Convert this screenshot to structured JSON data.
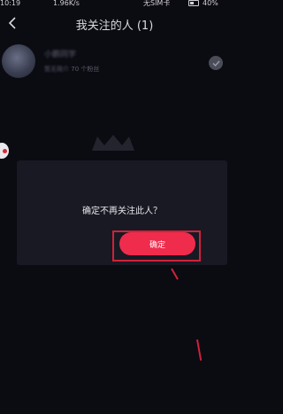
{
  "status_bar": {
    "time": "10:19",
    "speed": "1.96K/s",
    "carrier": "无SIM卡",
    "battery": "40%"
  },
  "header": {
    "title": "我关注的人 (1)",
    "back_icon": "chevron-left-icon"
  },
  "follow_list": [
    {
      "name": "小鹏同学",
      "meta_prefix": "暂无简介",
      "meta_fans": "70 个粉丝",
      "followed_icon": "check-icon"
    }
  ],
  "dialog": {
    "message": "确定不再关注此人？",
    "confirm_label": "确定"
  },
  "colors": {
    "background": "#0b0b12",
    "dialog": "#181923",
    "accent": "#f02c4d",
    "annotation": "#d0223a"
  }
}
